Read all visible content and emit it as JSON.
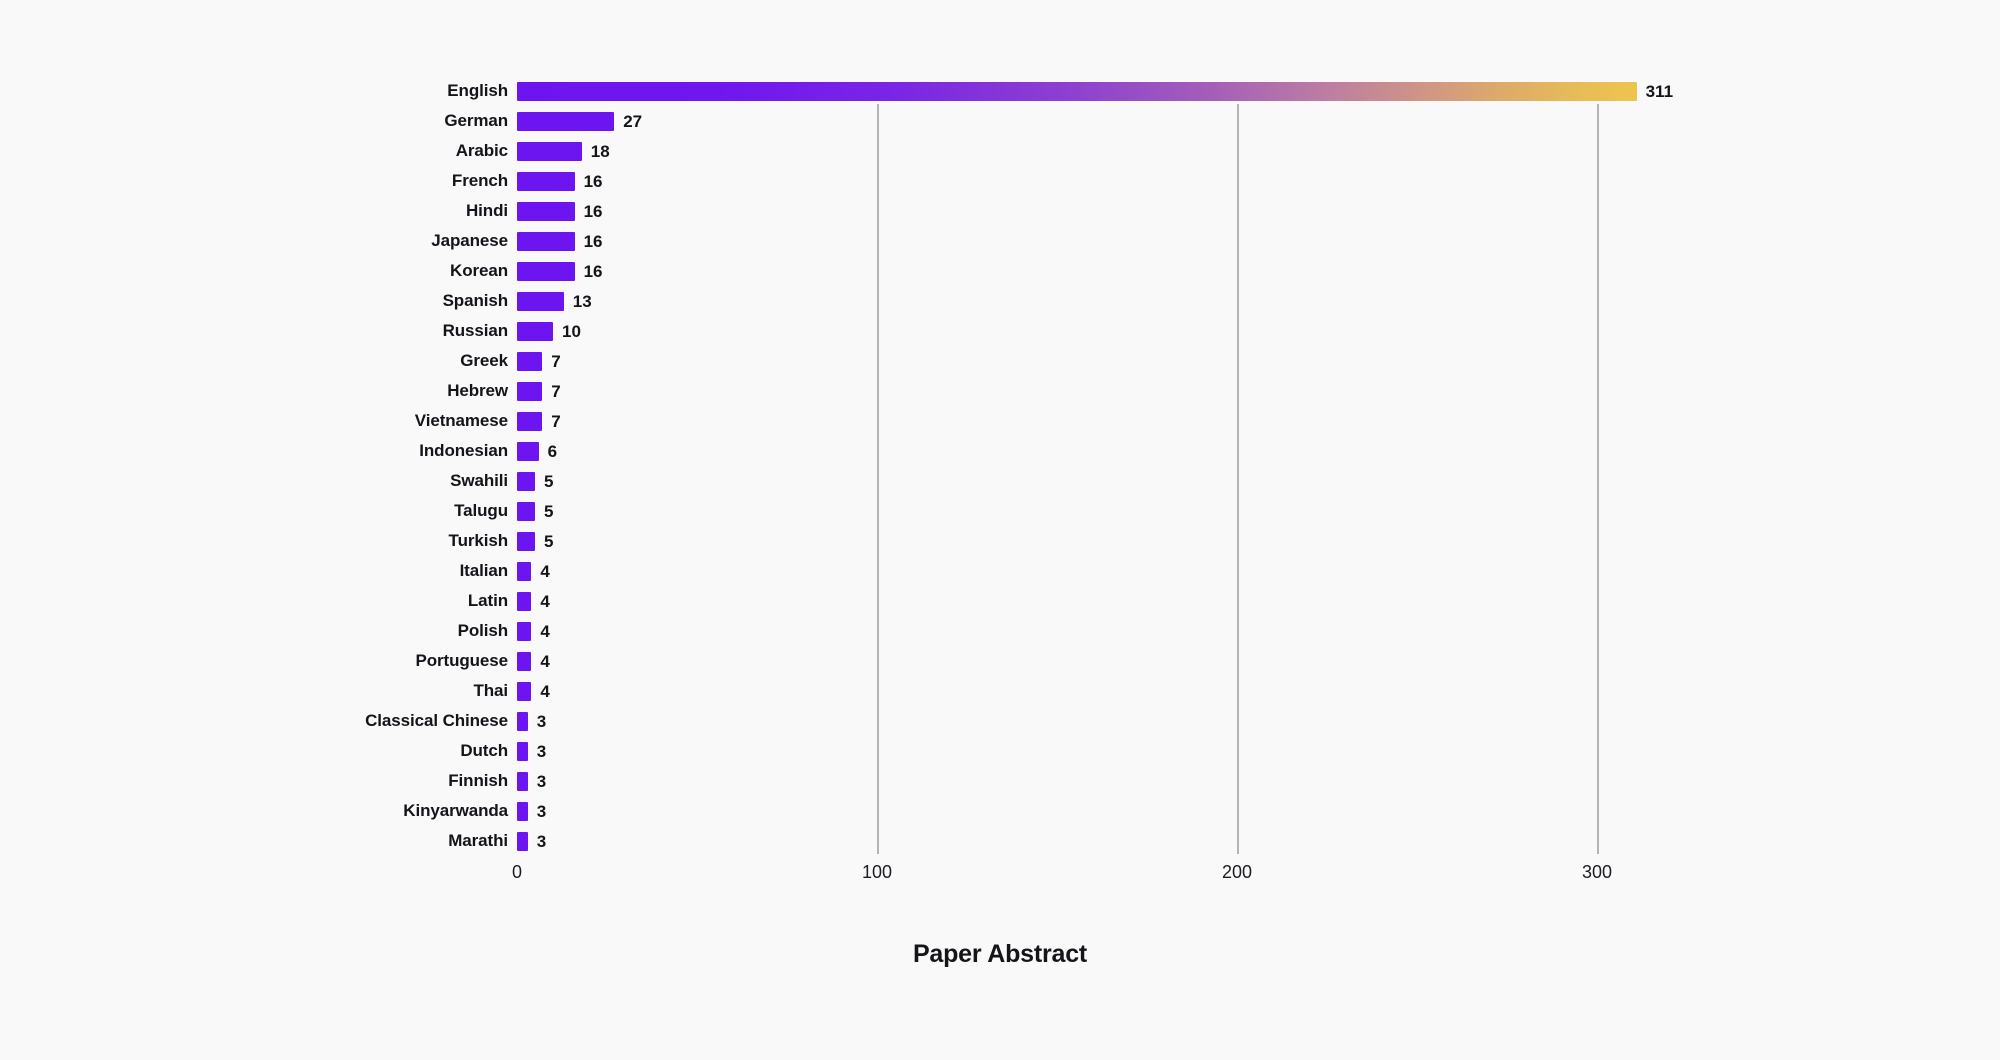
{
  "chart_data": {
    "type": "bar",
    "orientation": "horizontal",
    "title": "Paper Abstract",
    "xlabel": "",
    "ylabel": "",
    "xlim": [
      0,
      311
    ],
    "grid": true,
    "legend": "none",
    "x_ticks": [
      "0",
      "100",
      "200",
      "300"
    ],
    "x_tick_values": [
      0,
      100,
      200,
      300
    ],
    "categories": [
      "English",
      "German",
      "Arabic",
      "French",
      "Hindi",
      "Japanese",
      "Korean",
      "Spanish",
      "Russian",
      "Greek",
      "Hebrew",
      "Vietnamese",
      "Indonesian",
      "Swahili",
      "Talugu",
      "Turkish",
      "Italian",
      "Latin",
      "Polish",
      "Portuguese",
      "Thai",
      "Classical Chinese",
      "Dutch",
      "Finnish",
      "Kinyarwanda",
      "Marathi"
    ],
    "values": [
      311,
      27,
      18,
      16,
      16,
      16,
      16,
      13,
      10,
      7,
      7,
      7,
      6,
      5,
      5,
      5,
      4,
      4,
      4,
      4,
      4,
      3,
      3,
      3,
      3,
      3
    ],
    "value_labels": [
      "311",
      "27",
      "18",
      "16",
      "16",
      "16",
      "16",
      "13",
      "10",
      "7",
      "7",
      "7",
      "6",
      "5",
      "5",
      "5",
      "4",
      "4",
      "4",
      "4",
      "4",
      "3",
      "3",
      "3",
      "3",
      "3"
    ]
  },
  "colors": {
    "background": "#f9f9f9",
    "bar": "#6c15f0",
    "gradient_start": "#6c15f0",
    "gradient_end": "#eec44e",
    "gridline": "#b4b4b4",
    "text": "#14141a"
  }
}
